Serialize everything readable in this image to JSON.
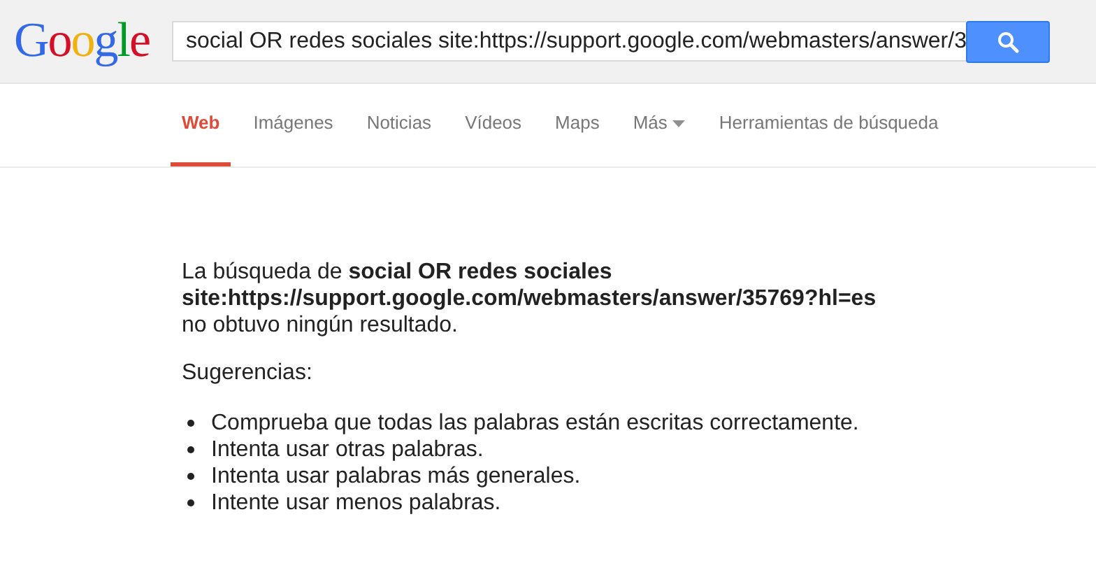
{
  "logo": [
    {
      "char": "G",
      "color": "#3369e8"
    },
    {
      "char": "o",
      "color": "#d50f25"
    },
    {
      "char": "o",
      "color": "#eeb211"
    },
    {
      "char": "g",
      "color": "#3369e8"
    },
    {
      "char": "l",
      "color": "#009925"
    },
    {
      "char": "e",
      "color": "#d50f25"
    }
  ],
  "search": {
    "value": "social OR redes sociales site:https://support.google.com/webmasters/answer/3"
  },
  "tabs": [
    {
      "label": "Web",
      "selected": true,
      "kind": "tab"
    },
    {
      "label": "Imágenes",
      "selected": false,
      "kind": "tab"
    },
    {
      "label": "Noticias",
      "selected": false,
      "kind": "tab"
    },
    {
      "label": "Vídeos",
      "selected": false,
      "kind": "tab"
    },
    {
      "label": "Maps",
      "selected": false,
      "kind": "tab"
    },
    {
      "label": "Más",
      "selected": false,
      "kind": "menu"
    },
    {
      "label": "Herramientas de búsqueda",
      "selected": false,
      "kind": "tools"
    }
  ],
  "message": "La búsqueda de **social OR redes sociales site:https://support.google.com/webmasters/answer/35769?hl=es** no obtuvo ningún resultado.",
  "suggestions_title": "Sugerencias:",
  "suggestions": [
    "Comprueba que todas las palabras están escritas correctamente.",
    "Intenta usar otras palabras.",
    "Intenta usar palabras más generales.",
    "Intente usar menos palabras."
  ]
}
